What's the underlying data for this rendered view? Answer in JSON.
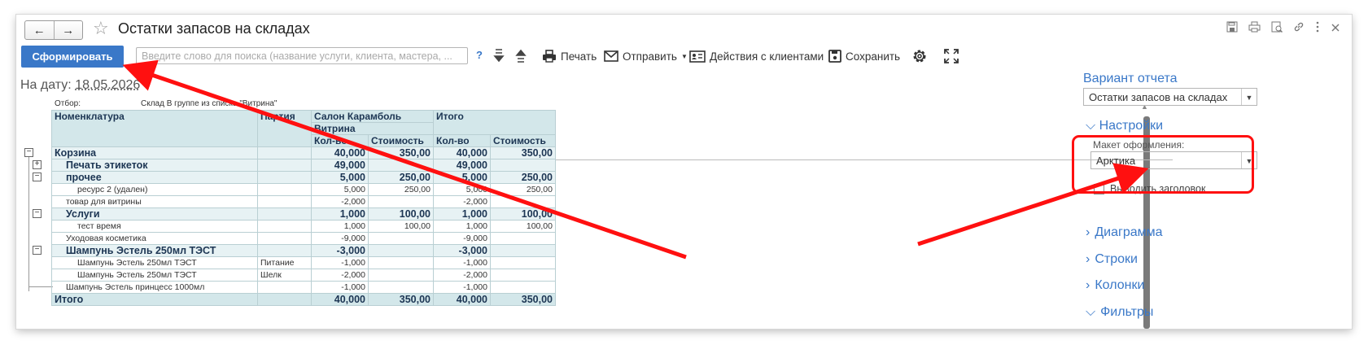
{
  "window": {
    "title": "Остатки запасов на складах",
    "back_icon": "←",
    "forward_icon": "→",
    "favorite_icon": "☆"
  },
  "window_icons": [
    "save-icon",
    "print-icon",
    "preview-icon",
    "link-icon",
    "more-icon",
    "close-icon"
  ],
  "toolbar": {
    "generate_label": "Сформировать",
    "search_placeholder": "Введите слово для поиска (название услуги, клиента, мастера, ...",
    "help_label": "?",
    "print_label": "Печать",
    "send_label": "Отправить",
    "client_actions_label": "Действия с клиентами",
    "save_label": "Сохранить"
  },
  "date": {
    "label": "На дату:",
    "value": "18.05.2026"
  },
  "report": {
    "filter_label": "Отбор:",
    "filter_value": "Склад В группе из списка \"Витрина\"",
    "headers": {
      "nomenclature": "Номенклатура",
      "batch": "Партия",
      "store": "Салон Карамболь",
      "showcase": "Витрина",
      "total": "Итого",
      "qty": "Кол-во",
      "cost": "Стоимость"
    },
    "rows": [
      {
        "name": "Корзина",
        "batch": "",
        "q1": "40,000",
        "c1": "350,00",
        "q2": "40,000",
        "c2": "350,00",
        "level": 0,
        "bold": true
      },
      {
        "name": "Печать этикеток",
        "batch": "",
        "q1": "49,000",
        "c1": "",
        "q2": "49,000",
        "c2": "",
        "level": 1,
        "bold": true
      },
      {
        "name": "прочее",
        "batch": "",
        "q1": "5,000",
        "c1": "250,00",
        "q2": "5,000",
        "c2": "250,00",
        "level": 1,
        "bold": true
      },
      {
        "name": "ресурс 2 (удален)",
        "batch": "",
        "q1": "5,000",
        "c1": "250,00",
        "q2": "5,000",
        "c2": "250,00",
        "level": 2,
        "bold": false
      },
      {
        "name": "товар для витрины",
        "batch": "",
        "q1": "-2,000",
        "c1": "",
        "q2": "-2,000",
        "c2": "",
        "level": 1,
        "bold": false
      },
      {
        "name": "Услуги",
        "batch": "",
        "q1": "1,000",
        "c1": "100,00",
        "q2": "1,000",
        "c2": "100,00",
        "level": 1,
        "bold": true
      },
      {
        "name": "тест время",
        "batch": "",
        "q1": "1,000",
        "c1": "100,00",
        "q2": "1,000",
        "c2": "100,00",
        "level": 2,
        "bold": false
      },
      {
        "name": "Уходовая косметика",
        "batch": "",
        "q1": "-9,000",
        "c1": "",
        "q2": "-9,000",
        "c2": "",
        "level": 1,
        "bold": false
      },
      {
        "name": "Шампунь Эстель 250мл ТЭСТ",
        "batch": "",
        "q1": "-3,000",
        "c1": "",
        "q2": "-3,000",
        "c2": "",
        "level": 1,
        "bold": true
      },
      {
        "name": "Шампунь Эстель 250мл ТЭСТ",
        "batch": "Питание",
        "q1": "-1,000",
        "c1": "",
        "q2": "-1,000",
        "c2": "",
        "level": 2,
        "bold": false
      },
      {
        "name": "Шампунь Эстель 250мл ТЭСТ",
        "batch": "Шелк",
        "q1": "-2,000",
        "c1": "",
        "q2": "-2,000",
        "c2": "",
        "level": 2,
        "bold": false
      },
      {
        "name": "Шампунь Эстель принцесс 1000мл",
        "batch": "",
        "q1": "-1,000",
        "c1": "",
        "q2": "-1,000",
        "c2": "",
        "level": 1,
        "bold": false
      }
    ],
    "total_row": {
      "name": "Итого",
      "q1": "40,000",
      "c1": "350,00",
      "q2": "40,000",
      "c2": "350,00"
    }
  },
  "settings_panel": {
    "variant_title": "Вариант отчета",
    "variant_value": "Остатки запасов на складах",
    "settings_label": "Настройки",
    "layout_label": "Макет оформления:",
    "layout_value": "Арктика",
    "show_header_label": "Выводить заголовок",
    "show_header_checked": false,
    "sections": [
      "Диаграмма",
      "Строки",
      "Колонки",
      "Фильтры"
    ]
  },
  "colors": {
    "accent": "#3a78c8",
    "annotation": "#ff1010",
    "table_header": "#d3e7ea"
  }
}
